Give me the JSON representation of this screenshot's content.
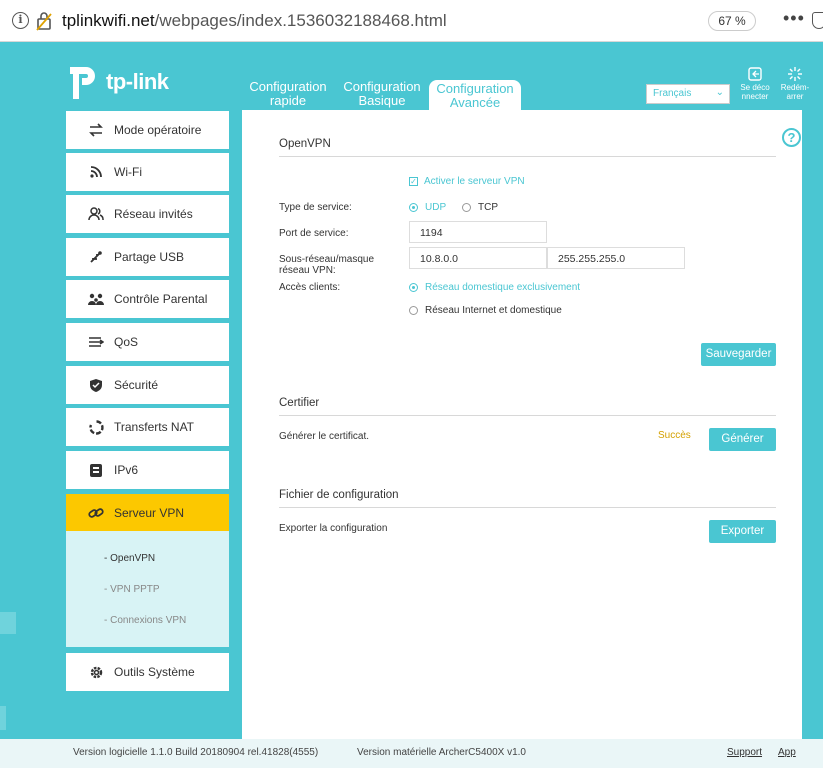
{
  "browser": {
    "url_host": "tplinkwifi.net",
    "url_path": "/webpages/index.1536032188468.html",
    "zoom": "67 %",
    "menu": "•••"
  },
  "header": {
    "logo_text": "tp-link",
    "tabs": [
      {
        "line1": "Configuration",
        "line2": "rapide"
      },
      {
        "line1": "Configuration",
        "line2": "Basique"
      },
      {
        "line1": "Configuration",
        "line2": "Avancée"
      }
    ],
    "language": "Français",
    "logout": {
      "line1": "Se déco",
      "line2": "nnecter"
    },
    "reboot": {
      "line1": "Redém-",
      "line2": "arrer"
    }
  },
  "sidebar": {
    "items": [
      {
        "label": "Mode opératoire",
        "icon": "swap-icon"
      },
      {
        "label": "Wi-Fi",
        "icon": "wifi-icon"
      },
      {
        "label": "Réseau invités",
        "icon": "guests-icon"
      },
      {
        "label": "Partage USB",
        "icon": "usb-icon"
      },
      {
        "label": "Contrôle Parental",
        "icon": "family-icon"
      },
      {
        "label": "QoS",
        "icon": "qos-icon"
      },
      {
        "label": "Sécurité",
        "icon": "shield-icon"
      },
      {
        "label": "Transferts NAT",
        "icon": "nat-icon"
      },
      {
        "label": "IPv6",
        "icon": "ipv6-icon"
      },
      {
        "label": "Serveur VPN",
        "icon": "link-icon"
      },
      {
        "label": "Outils Système",
        "icon": "gear-icon"
      }
    ],
    "subitems": [
      {
        "label": "- OpenVPN"
      },
      {
        "label": "- VPN PPTP"
      },
      {
        "label": "- Connexions VPN"
      }
    ]
  },
  "openvpn": {
    "title": "OpenVPN",
    "enable_label": "Activer le serveur VPN",
    "service_type_label": "Type de service:",
    "udp": "UDP",
    "tcp": "TCP",
    "port_label": "Port de service:",
    "port_value": "1194",
    "subnet_label_1": "Sous-réseau/masque",
    "subnet_label_2": "réseau VPN:",
    "subnet_value": "10.8.0.0",
    "mask_value": "255.255.255.0",
    "access_label": "Accès clients:",
    "access_opt1": "Réseau domestique exclusivement",
    "access_opt2": "Réseau Internet et domestique",
    "save": "Sauvegarder"
  },
  "certifier": {
    "title": "Certifier",
    "generate_label": "Générer le certificat.",
    "status": "Succès",
    "generate_btn": "Générer"
  },
  "config_file": {
    "title": "Fichier de configuration",
    "export_label": "Exporter la configuration",
    "export_btn": "Exporter"
  },
  "footer": {
    "firmware": "Version logicielle 1.1.0 Build 20180904 rel.41828(4555)",
    "hardware": "Version matérielle ArcherC5400X v1.0",
    "support": "Support",
    "app": "App"
  },
  "colors": {
    "accent": "#4ac6d2",
    "active_menu": "#fcc800",
    "success": "#d4a100"
  }
}
